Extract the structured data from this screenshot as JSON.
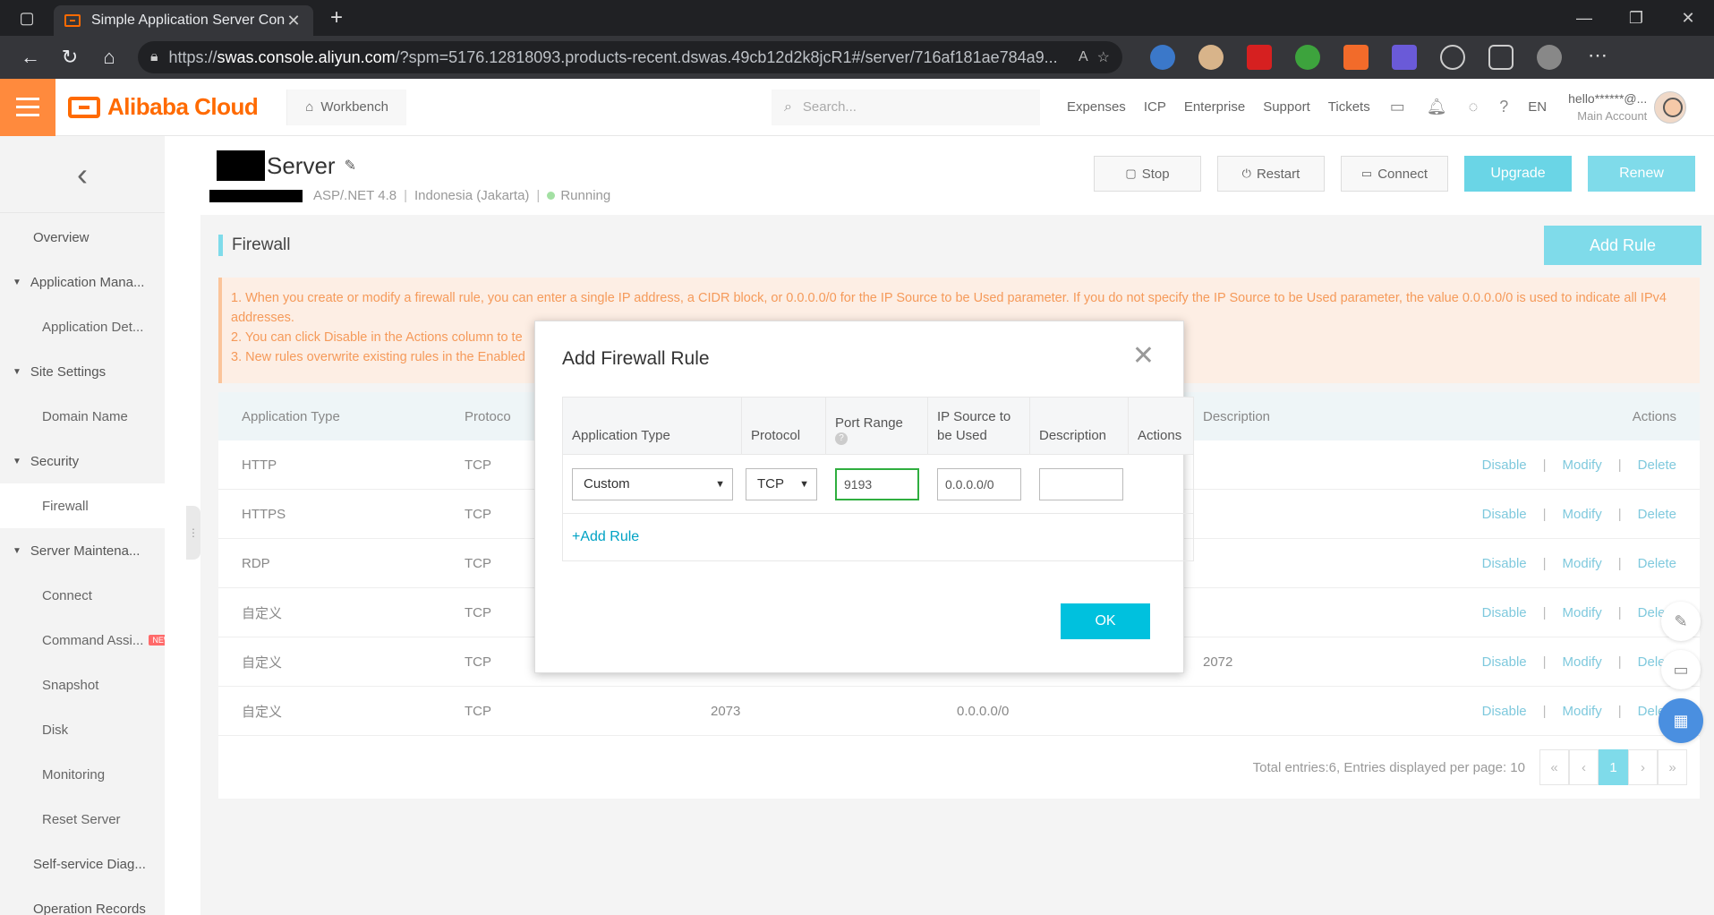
{
  "browser": {
    "tab_title": "Simple Application Server Conso",
    "url_host": "swas.console.aliyun.com",
    "url_prefix": "https://",
    "url_rest": "/?spm=5176.12818093.products-recent.dswas.49cb12d2k8jcR1#/server/716af181ae784a9..."
  },
  "header": {
    "brand": "Alibaba Cloud",
    "workbench": "Workbench",
    "search_placeholder": "Search...",
    "nav": [
      "Expenses",
      "ICP",
      "Enterprise",
      "Support",
      "Tickets"
    ],
    "lang": "EN",
    "user": "hello******@...",
    "role": "Main Account"
  },
  "sidebar": {
    "items": [
      {
        "label": "Overview",
        "kind": "item"
      },
      {
        "label": "Application Mana...",
        "kind": "group"
      },
      {
        "label": "Application Det...",
        "kind": "sub"
      },
      {
        "label": "Site Settings",
        "kind": "group"
      },
      {
        "label": "Domain Name",
        "kind": "sub"
      },
      {
        "label": "Security",
        "kind": "group"
      },
      {
        "label": "Firewall",
        "kind": "sub-active"
      },
      {
        "label": "Server Maintena...",
        "kind": "group"
      },
      {
        "label": "Connect",
        "kind": "sub"
      },
      {
        "label": "Command Assi...",
        "kind": "sub",
        "badge": "NEW"
      },
      {
        "label": "Snapshot",
        "kind": "sub"
      },
      {
        "label": "Disk",
        "kind": "sub"
      },
      {
        "label": "Monitoring",
        "kind": "sub"
      },
      {
        "label": "Reset Server",
        "kind": "sub"
      },
      {
        "label": "Self-service Diag...",
        "kind": "item"
      },
      {
        "label": "Operation Records",
        "kind": "item"
      }
    ]
  },
  "server": {
    "title": "Server",
    "app": "ASP/.NET 4.8",
    "region": "Indonesia (Jakarta)",
    "status": "Running",
    "buttons": {
      "stop": "Stop",
      "restart": "Restart",
      "connect": "Connect",
      "upgrade": "Upgrade",
      "renew": "Renew"
    }
  },
  "firewall": {
    "title": "Firewall",
    "add_rule": "Add Rule",
    "notice": [
      "1. When you create or modify a firewall rule, you can enter a single IP address, a CIDR block, or 0.0.0.0/0 for the IP Source to be Used parameter. If you do not specify the IP Source to be Used parameter, the value 0.0.0.0/0 is used to indicate all IPv4 addresses.",
      "2. You can click Disable in the Actions column to te",
      "3. New rules overwrite existing rules in the Enabled"
    ],
    "columns": [
      "Application Type",
      "Protoco",
      "",
      "",
      "Description",
      "Actions"
    ],
    "rows": [
      {
        "type": "HTTP",
        "protocol": "TCP",
        "port": "",
        "source": "",
        "desc": ""
      },
      {
        "type": "HTTPS",
        "protocol": "TCP",
        "port": "",
        "source": "",
        "desc": ""
      },
      {
        "type": "RDP",
        "protocol": "TCP",
        "port": "",
        "source": "",
        "desc": ""
      },
      {
        "type": "自定义",
        "protocol": "TCP",
        "port": "",
        "source": "",
        "desc": ""
      },
      {
        "type": "自定义",
        "protocol": "TCP",
        "port": "",
        "source": "",
        "desc": "2072"
      },
      {
        "type": "自定义",
        "protocol": "TCP",
        "port": "2073",
        "source": "0.0.0.0/0",
        "desc": ""
      }
    ],
    "row_actions": {
      "disable": "Disable",
      "modify": "Modify",
      "delete": "Delete"
    },
    "pagination": {
      "summary": "Total entries:6, Entries displayed per page: 10",
      "first": "«",
      "prev": "‹",
      "current": "1",
      "next": "›",
      "last": "»"
    }
  },
  "dialog": {
    "title": "Add Firewall Rule",
    "columns": {
      "app_type": "Application Type",
      "protocol": "Protocol",
      "port_range": "Port Range",
      "ip_source_1": "IP Source to",
      "ip_source_2": "be Used",
      "description": "Description",
      "actions": "Actions"
    },
    "row": {
      "app_type": "Custom",
      "protocol": "TCP",
      "port_range": "9193",
      "ip_source": "0.0.0.0/0",
      "description": ""
    },
    "add_rule_link": "+Add Rule",
    "ok": "OK"
  }
}
